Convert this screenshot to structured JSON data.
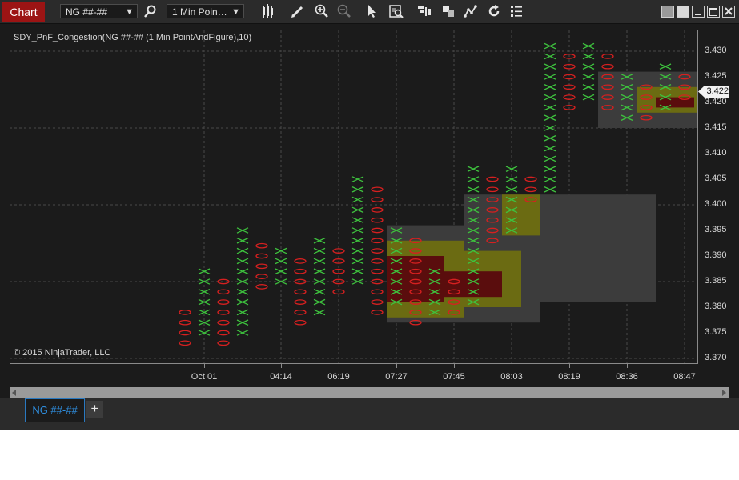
{
  "toolbar": {
    "chart_tab_label": "Chart",
    "instrument_value": "NG ##-##",
    "interval_value": "1 Min Poin…",
    "icons": [
      "search-icon",
      "bar-style-icon",
      "draw-pencil-icon",
      "zoom-in-icon",
      "zoom-out-icon",
      "pointer-icon",
      "data-box-icon",
      "chart-trader-icon",
      "properties-icon",
      "indicators-icon",
      "reload-icon",
      "list-icon"
    ],
    "window_icons": [
      "tile-icon",
      "tile-icon-2",
      "minimize-icon",
      "maximize-icon",
      "close-icon"
    ]
  },
  "chart": {
    "indicator_label": "SDY_PnF_Congestion(NG ##-## (1 Min PointAndFigure),10)",
    "copyright": "© 2015 NinjaTrader, LLC",
    "current_price": "3.422",
    "y_ticks": [
      "3.430",
      "3.425",
      "3.420",
      "3.415",
      "3.410",
      "3.405",
      "3.400",
      "3.395",
      "3.390",
      "3.385",
      "3.380",
      "3.375",
      "3.370"
    ],
    "x_ticks": [
      "Oct 01",
      "04:14",
      "06:19",
      "07:27",
      "07:45",
      "08:03",
      "08:19",
      "08:36",
      "08:47"
    ]
  },
  "chart_data": {
    "type": "point-and-figure",
    "box_size": 0.001,
    "ylim": [
      3.37,
      3.43
    ],
    "colors": {
      "x": "#3ec23e",
      "o": "#d62020",
      "zone_gray": "#3c3c3c",
      "zone_olive": "#6b6b12",
      "zone_maroon": "#5a0d0d",
      "price_marker": "#f2f2f2"
    },
    "columns": [
      {
        "type": "O",
        "high": 3.379,
        "low": 3.373
      },
      {
        "type": "X",
        "high": 3.387,
        "low": 3.375
      },
      {
        "type": "O",
        "high": 3.385,
        "low": 3.373
      },
      {
        "type": "X",
        "high": 3.395,
        "low": 3.375
      },
      {
        "type": "O",
        "high": 3.393,
        "low": 3.384
      },
      {
        "type": "X",
        "high": 3.391,
        "low": 3.385
      },
      {
        "type": "O",
        "high": 3.389,
        "low": 3.377
      },
      {
        "type": "X",
        "high": 3.393,
        "low": 3.379
      },
      {
        "type": "O",
        "high": 3.391,
        "low": 3.383
      },
      {
        "type": "X",
        "high": 3.405,
        "low": 3.385
      },
      {
        "type": "O",
        "high": 3.403,
        "low": 3.379
      },
      {
        "type": "X",
        "high": 3.395,
        "low": 3.381
      },
      {
        "type": "O",
        "high": 3.393,
        "low": 3.377
      },
      {
        "type": "X",
        "high": 3.387,
        "low": 3.379
      },
      {
        "type": "O",
        "high": 3.385,
        "low": 3.379
      },
      {
        "type": "X",
        "high": 3.407,
        "low": 3.381
      },
      {
        "type": "O",
        "high": 3.405,
        "low": 3.393
      },
      {
        "type": "X",
        "high": 3.407,
        "low": 3.395
      },
      {
        "type": "O",
        "high": 3.405,
        "low": 3.401
      },
      {
        "type": "X",
        "high": 3.431,
        "low": 3.403
      },
      {
        "type": "O",
        "high": 3.429,
        "low": 3.419
      },
      {
        "type": "X",
        "high": 3.431,
        "low": 3.421
      },
      {
        "type": "O",
        "high": 3.429,
        "low": 3.419
      },
      {
        "type": "X",
        "high": 3.425,
        "low": 3.417
      },
      {
        "type": "O",
        "high": 3.423,
        "low": 3.417
      },
      {
        "type": "X",
        "high": 3.427,
        "low": 3.419
      },
      {
        "type": "O",
        "high": 3.425,
        "low": 3.421
      }
    ],
    "zones": [
      {
        "color": "zone_gray",
        "col_start": 10.5,
        "col_end": 18.5,
        "high": 3.396,
        "low": 3.377
      },
      {
        "color": "zone_gray",
        "col_start": 14.5,
        "col_end": 24.5,
        "high": 3.402,
        "low": 3.381
      },
      {
        "color": "zone_olive",
        "col_start": 10.5,
        "col_end": 14.5,
        "high": 3.393,
        "low": 3.378
      },
      {
        "color": "zone_olive",
        "col_start": 13.5,
        "col_end": 17.5,
        "high": 3.391,
        "low": 3.38
      },
      {
        "color": "zone_olive",
        "col_start": 16.5,
        "col_end": 18.5,
        "high": 3.402,
        "low": 3.394
      },
      {
        "color": "zone_maroon",
        "col_start": 10.5,
        "col_end": 13.5,
        "high": 3.39,
        "low": 3.381
      },
      {
        "color": "zone_maroon",
        "col_start": 13.5,
        "col_end": 16.5,
        "high": 3.387,
        "low": 3.382
      },
      {
        "color": "zone_gray",
        "col_start": 21.5,
        "col_end": 27.5,
        "high": 3.426,
        "low": 3.415
      },
      {
        "color": "zone_olive",
        "col_start": 23.5,
        "col_end": 27.5,
        "high": 3.423,
        "low": 3.418
      },
      {
        "color": "zone_maroon",
        "col_start": 24.5,
        "col_end": 26.5,
        "high": 3.421,
        "low": 3.419
      }
    ]
  },
  "tabs": {
    "active_label": "NG ##-##",
    "add_label": "+"
  }
}
